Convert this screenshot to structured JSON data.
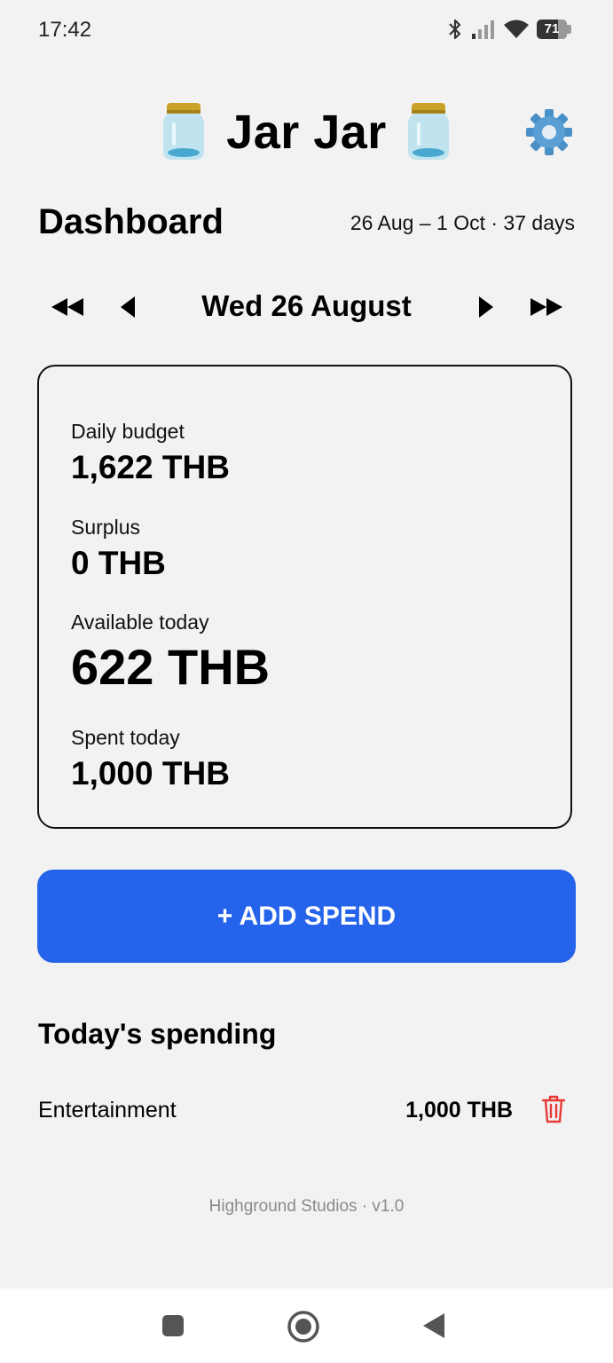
{
  "status_bar": {
    "time": "17:42",
    "battery": "71",
    "icons": [
      "bluetooth-icon",
      "signal-icon",
      "wifi-icon",
      "battery-icon"
    ]
  },
  "header": {
    "title": "Jar Jar",
    "icon_left": "jar-icon",
    "icon_right": "jar-icon",
    "settings_icon": "gear-icon"
  },
  "dashboard": {
    "title": "Dashboard",
    "range": "26 Aug – 1 Oct · 37 days"
  },
  "date_nav": {
    "date": "Wed 26 August",
    "icons": [
      "fast-back-icon",
      "back-icon",
      "forward-icon",
      "fast-forward-icon"
    ]
  },
  "summary": {
    "daily_budget_label": "Daily budget",
    "daily_budget_value": "1,622 THB",
    "surplus_label": "Surplus",
    "surplus_value": "0 THB",
    "available_label": "Available today",
    "available_value": "622 THB",
    "spent_label": "Spent today",
    "spent_value": "1,000 THB"
  },
  "actions": {
    "add_spend": "+ ADD SPEND"
  },
  "spending": {
    "title": "Today's spending",
    "items": [
      {
        "category": "Entertainment",
        "amount": "1,000 THB",
        "icon": "trash-icon"
      }
    ]
  },
  "footer": {
    "text": "Highground Studios · v1.0"
  },
  "colors": {
    "accent": "#2563eb",
    "background": "#f2f2f2",
    "delete": "#e53935"
  }
}
